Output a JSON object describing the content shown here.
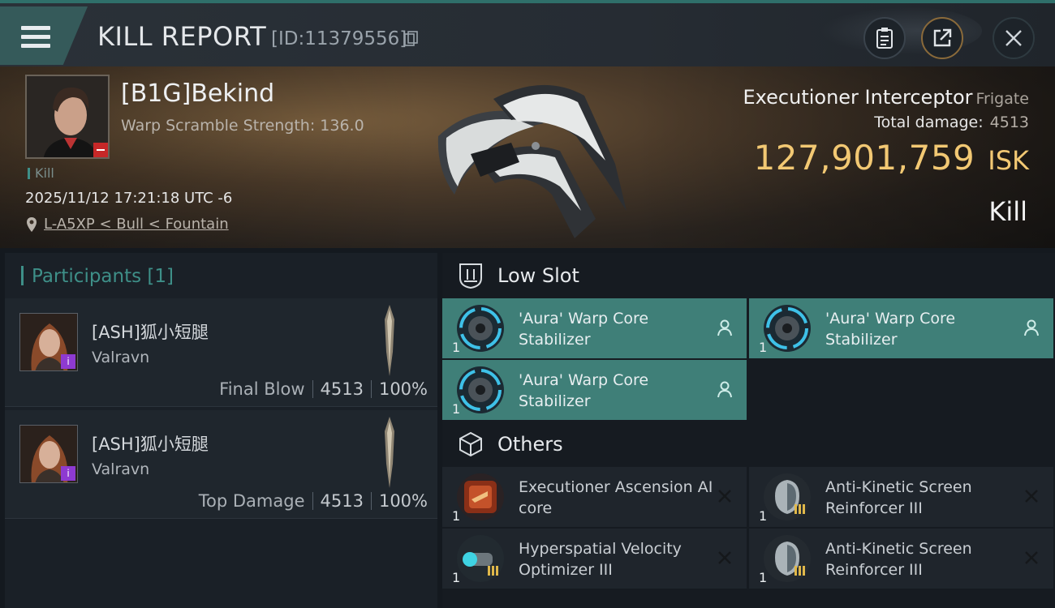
{
  "header": {
    "title": "KILL REPORT",
    "report_id": "[ID:11379556]"
  },
  "victim": {
    "name": "[B1G]Bekind",
    "warp_scramble": "Warp Scramble Strength: 136.0",
    "tag": "Kill",
    "datetime": "2025/11/12 17:21:18 UTC -6",
    "location": "L-A5XP < Bull < Fountain",
    "ship_name": "Executioner Interceptor",
    "ship_class": "Frigate",
    "total_damage_label": "Total damage:",
    "total_damage_value": "4513",
    "isk_value": "127,901,759",
    "isk_unit": "ISK",
    "result": "Kill"
  },
  "participants": {
    "title": "Participants [1]",
    "rows": [
      {
        "name": "[ASH]狐小短腿",
        "corp": "Valravn",
        "role": "Final Blow",
        "damage": "4513",
        "percent": "100%"
      },
      {
        "name": "[ASH]狐小短腿",
        "corp": "Valravn",
        "role": "Top Damage",
        "damage": "4513",
        "percent": "100%"
      }
    ]
  },
  "fitting": {
    "low_slot": {
      "label": "Low Slot",
      "items": [
        {
          "name": "'Aura' Warp Core Stabilizer",
          "qty": "1",
          "status": "fitted"
        },
        {
          "name": "'Aura' Warp Core Stabilizer",
          "qty": "1",
          "status": "fitted"
        },
        {
          "name": "'Aura' Warp Core Stabilizer",
          "qty": "1",
          "status": "fitted"
        }
      ]
    },
    "others": {
      "label": "Others",
      "items": [
        {
          "name": "Executioner Ascension AI core",
          "qty": "1",
          "status": "destroyed"
        },
        {
          "name": "Anti-Kinetic Screen Reinforcer III",
          "qty": "1",
          "status": "destroyed"
        },
        {
          "name": "Hyperspatial Velocity Optimizer III",
          "qty": "1",
          "status": "destroyed"
        },
        {
          "name": "Anti-Kinetic Screen Reinforcer III",
          "qty": "1",
          "status": "destroyed"
        }
      ]
    }
  },
  "colors": {
    "accent_teal": "#3e8f88",
    "isk_gold": "#f2c873",
    "fitted_slot": "#3f7f78",
    "kill_red": "#c62828"
  },
  "icons": [
    "menu-icon",
    "copy-icon",
    "clipboard-icon",
    "share-icon",
    "close-icon",
    "location-pin-icon",
    "low-slot-icon",
    "cube-icon",
    "pilot-icon",
    "destroyed-x-icon"
  ]
}
